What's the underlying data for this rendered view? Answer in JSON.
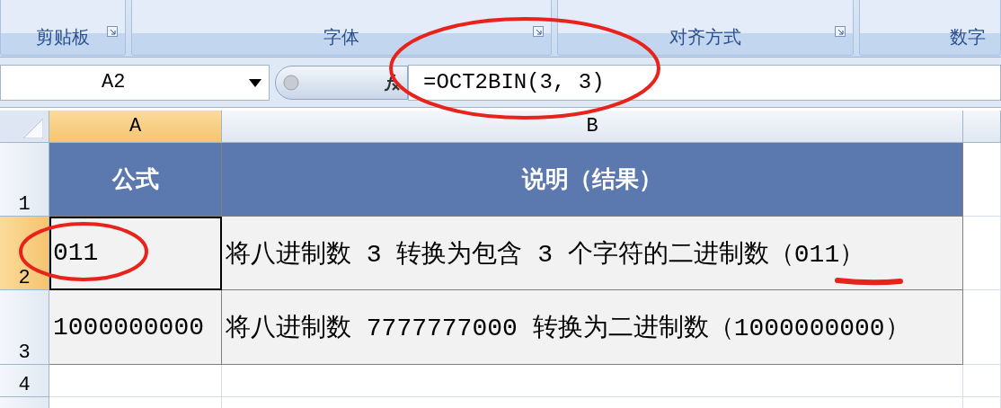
{
  "ribbon": {
    "groups": [
      {
        "label": "剪贴板",
        "launcher": true
      },
      {
        "label": "字体",
        "launcher": true
      },
      {
        "label": "对齐方式",
        "launcher": true
      },
      {
        "label": "数字",
        "launcher": false
      }
    ]
  },
  "formula_bar": {
    "name_box": "A2",
    "formula": "=OCT2BIN(3, 3)"
  },
  "columns": [
    {
      "label": "A",
      "selected": true
    },
    {
      "label": "B",
      "selected": false
    }
  ],
  "rows": [
    {
      "number": "1",
      "selected": false,
      "cells": [
        {
          "text": "公式",
          "kind": "header",
          "active": false
        },
        {
          "text": "说明（结果）",
          "kind": "header",
          "active": false
        }
      ]
    },
    {
      "number": "2",
      "selected": true,
      "cells": [
        {
          "text": "011",
          "kind": "data",
          "active": true
        },
        {
          "text": "将八进制数 3 转换为包含 3 个字符的二进制数（011）",
          "kind": "data",
          "active": false
        }
      ]
    },
    {
      "number": "3",
      "selected": false,
      "cells": [
        {
          "text": "1000000000",
          "kind": "data",
          "active": false
        },
        {
          "text": "将八进制数 7777777000 转换为二进制数（1000000000）",
          "kind": "data",
          "active": false
        }
      ]
    },
    {
      "number": "4",
      "selected": false
    }
  ],
  "annotations": [
    {
      "kind": "ellipse"
    },
    {
      "kind": "ellipse"
    },
    {
      "kind": "underline"
    }
  ]
}
